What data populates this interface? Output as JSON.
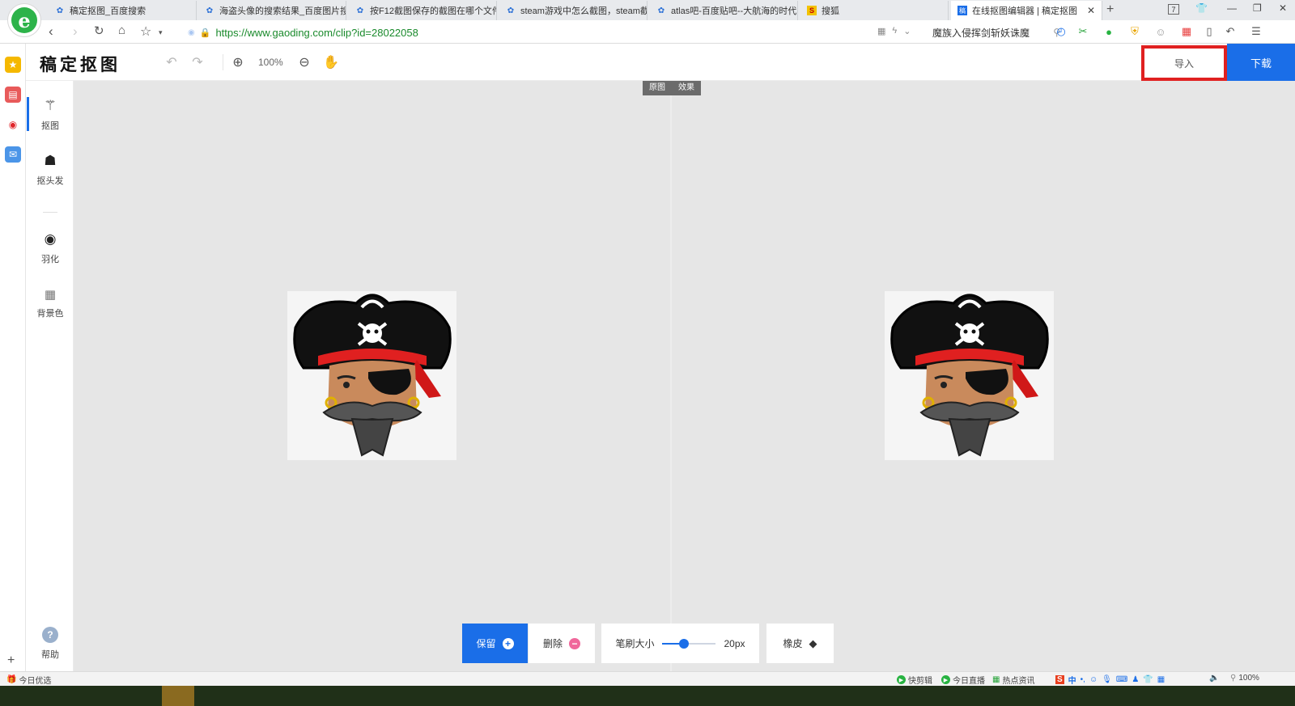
{
  "browser": {
    "tabs": [
      {
        "title": "稿定抠图_百度搜索",
        "favicon": "paw-icon"
      },
      {
        "title": "海盗头像的搜索结果_百度图片搜",
        "favicon": "paw-icon"
      },
      {
        "title": "按F12截图保存的截图在哪个文件",
        "favicon": "paw-icon"
      },
      {
        "title": "steam游戏中怎么截图，steam截",
        "favicon": "paw-icon"
      },
      {
        "title": "atlas吧-百度贴吧--大航海的时代",
        "favicon": "paw-icon"
      },
      {
        "title": "搜狐",
        "favicon": "sohu-icon"
      },
      {
        "title": "在线抠图编辑器 | 稿定抠图",
        "favicon": "gaoding-icon",
        "active": true
      }
    ],
    "tab_count": "7",
    "url": "https://www.gaoding.com/clip?id=28022058",
    "search_text": "魔族入侵挥剑斩妖诛魔"
  },
  "app": {
    "logo": "稿定抠图",
    "zoom": "100%",
    "import_label": "导入",
    "download_label": "下载",
    "view_toggle": {
      "original": "原图",
      "effect": "效果"
    },
    "tools": [
      {
        "label": "抠图",
        "icon": "magic-wand-icon",
        "active": true
      },
      {
        "label": "抠头发",
        "icon": "hair-head-icon"
      },
      {
        "label": "羽化",
        "icon": "feather-circle-icon"
      },
      {
        "label": "背景色",
        "icon": "background-grid-icon"
      }
    ],
    "help_label": "帮助",
    "bottom": {
      "keep_label": "保留",
      "delete_label": "删除",
      "brush_label": "笔刷大小",
      "brush_value": "20px",
      "brush_fraction": 0.4,
      "eraser_label": "橡皮"
    },
    "images": {
      "left_alt": "pirate-avatar-original",
      "right_alt": "pirate-avatar-effect"
    }
  },
  "statusbar": {
    "left": "今日优选",
    "items": [
      "快剪辑",
      "今日直播",
      "热点资讯"
    ],
    "zoom": "100%"
  },
  "colors": {
    "accent": "#1a6ee8",
    "highlight_box": "#e02020",
    "canvas": "#e6e6e6"
  }
}
